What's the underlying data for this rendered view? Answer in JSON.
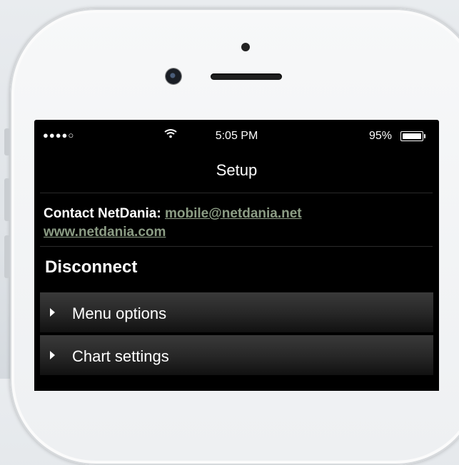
{
  "status_bar": {
    "signal": "●●●●○",
    "time": "5:05 PM",
    "battery": "95%",
    "battery_level": 0.95
  },
  "nav": {
    "title": "Setup"
  },
  "contact": {
    "label": "Contact NetDania: ",
    "email": "mobile@netdania.net",
    "website": "www.netdania.com"
  },
  "actions": {
    "disconnect": "Disconnect"
  },
  "sections": [
    {
      "label": "Menu options"
    },
    {
      "label": "Chart settings"
    }
  ],
  "icons": [
    "wifi-icon",
    "battery-icon",
    "caret-right-icon"
  ],
  "colors": {
    "link": "#8c9d85",
    "background": "#000000",
    "text": "#ffffff"
  }
}
